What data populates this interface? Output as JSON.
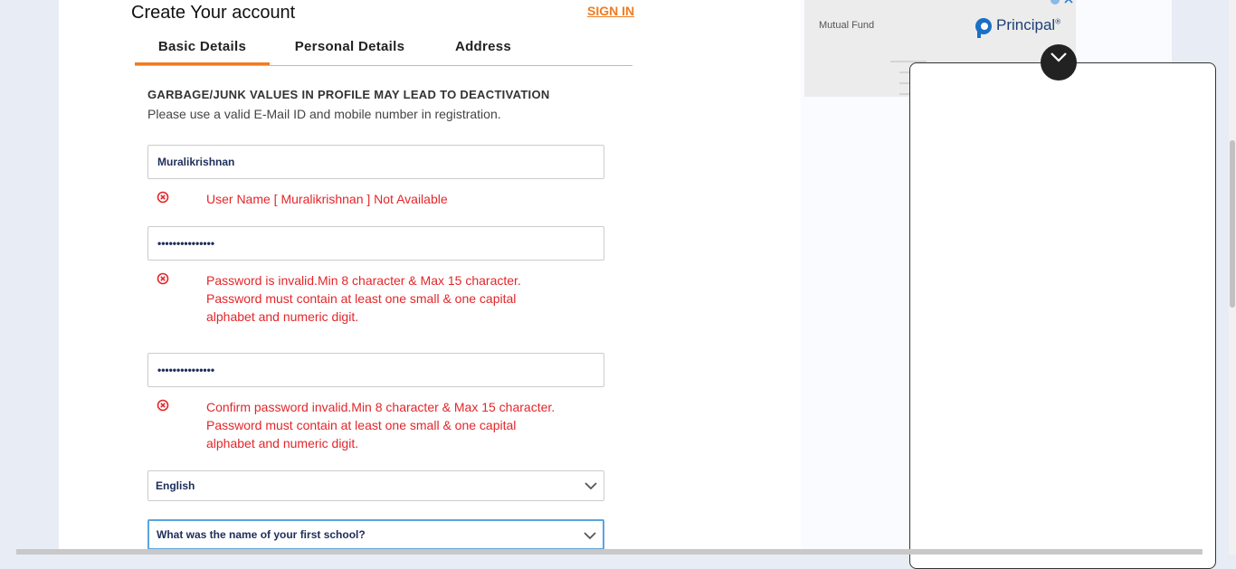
{
  "header": {
    "title": "Create Your account",
    "signin_label": "SIGN IN"
  },
  "tabs": [
    {
      "label": "Basic Details",
      "active": true
    },
    {
      "label": "Personal Details",
      "active": false
    },
    {
      "label": "Address",
      "active": false
    }
  ],
  "notice": {
    "title": "GARBAGE/JUNK VALUES IN PROFILE MAY LEAD TO DEACTIVATION",
    "subtitle": "Please use a valid E-Mail ID and mobile number in registration."
  },
  "form": {
    "username": {
      "value": "Muralikrishnan",
      "error": "User Name [ Muralikrishnan ] Not Available"
    },
    "password": {
      "value": "•••••••••••••••",
      "error_lines": [
        "Password is invalid.Min 8 character & Max 15 character.",
        "Password must contain at least one small & one capital",
        "alphabet and numeric digit."
      ]
    },
    "confirm_password": {
      "value": "•••••••••••••••",
      "error_lines": [
        "Confirm password invalid.Min 8 character & Max 15 character.",
        "Password must contain at least one small & one capital",
        "alphabet and numeric digit."
      ]
    },
    "language": {
      "selected": "English"
    },
    "security_question": {
      "selected": "What was the name of your first school?"
    }
  },
  "ad": {
    "label": "Mutual Fund",
    "brand": "Principal",
    "brand_mark": "®"
  },
  "colors": {
    "accent": "#f07c22",
    "error": "#e3262a",
    "input_text": "#1d2e5a",
    "focus": "#5aa4e0"
  }
}
